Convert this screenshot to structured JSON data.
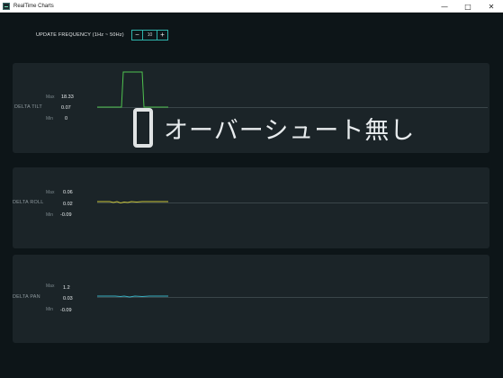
{
  "window": {
    "title": "RealTime Charts",
    "minimize_icon": "minimize-icon",
    "maximize_icon": "maximize-icon",
    "close_icon": "close-icon"
  },
  "update_frequency": {
    "label": "UPDATE FREQUENCY (1Hz ~ 50Hz)",
    "value": "10",
    "decrement": "−",
    "increment": "+"
  },
  "overlay": {
    "text": "オーバーシュート無し"
  },
  "stat_labels": {
    "max": "Max",
    "min": "Min"
  },
  "channels": [
    {
      "name": "DELTA TILT",
      "max": "18.33",
      "current": "0.07",
      "min": "0",
      "color": "#4fc24f"
    },
    {
      "name": "DELTA ROLL",
      "max": "0.06",
      "current": "0.02",
      "min": "-0.09",
      "color": "#c9c53a"
    },
    {
      "name": "DELTA PAN",
      "max": "1.2",
      "current": "0.03",
      "min": "-0.09",
      "color": "#3ab0c2"
    }
  ],
  "colors": {
    "background": "#0d1518",
    "panel": "#1b2428",
    "accent": "#2fb3ab"
  }
}
